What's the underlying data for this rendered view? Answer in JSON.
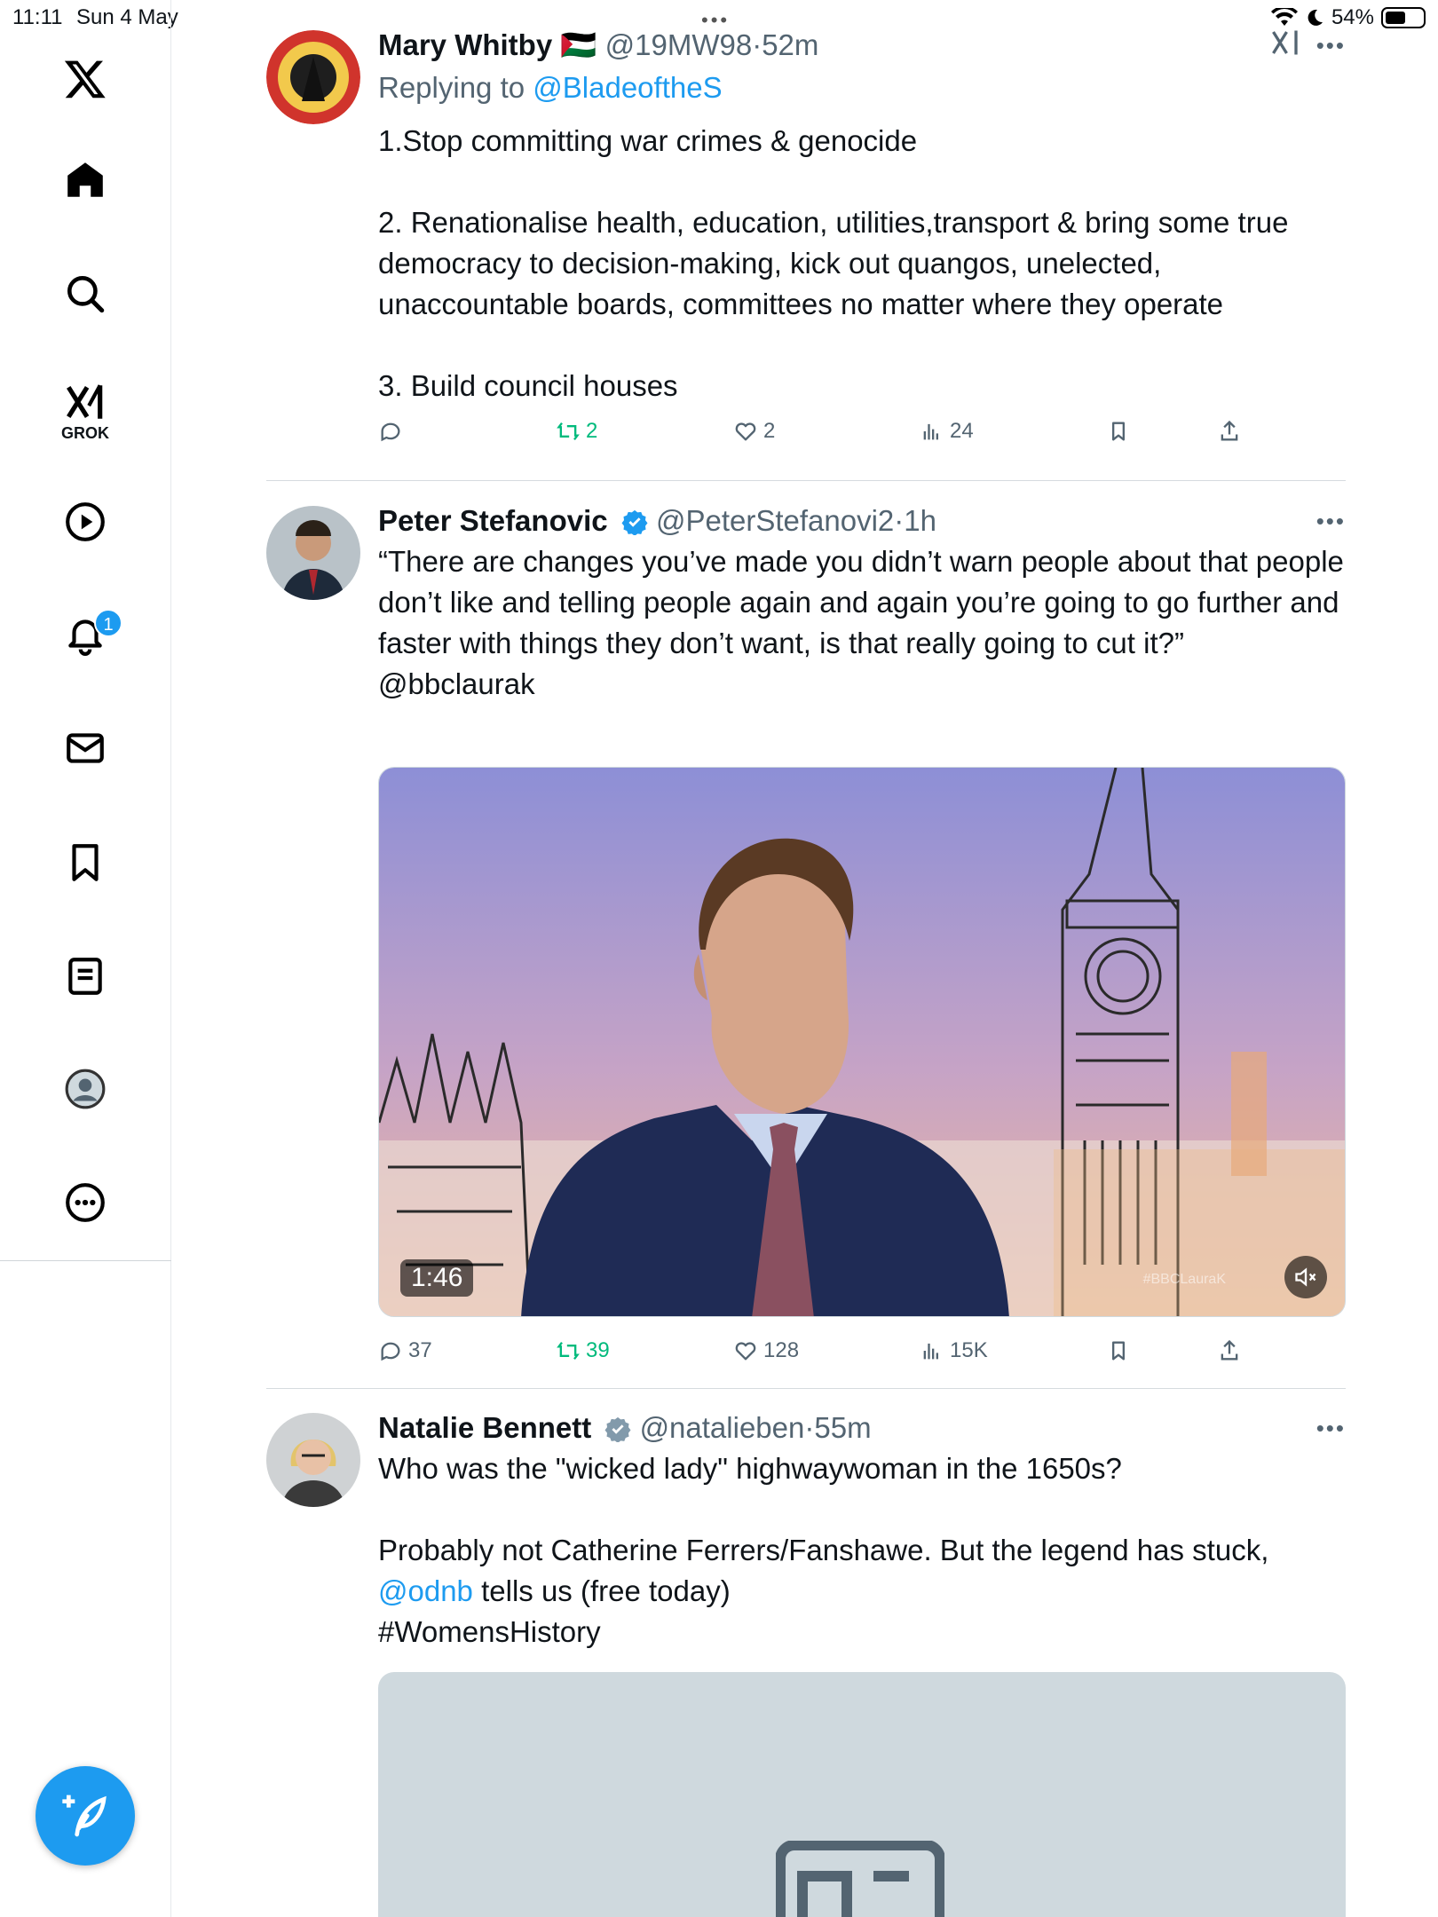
{
  "status_bar": {
    "time": "11:11",
    "date": "Sun 4 May",
    "battery": "54%"
  },
  "sidebar": {
    "items": [
      {
        "name": "logo",
        "icon": "x-logo-icon"
      },
      {
        "name": "home",
        "icon": "home-icon"
      },
      {
        "name": "explore",
        "icon": "search-icon"
      },
      {
        "name": "grok",
        "icon": "grok-icon",
        "label": "GROK"
      },
      {
        "name": "videos",
        "icon": "play-icon"
      },
      {
        "name": "notifications",
        "icon": "bell-icon",
        "badge": "1"
      },
      {
        "name": "messages",
        "icon": "mail-icon"
      },
      {
        "name": "bookmarks",
        "icon": "bookmark-icon"
      },
      {
        "name": "lists",
        "icon": "list-icon"
      },
      {
        "name": "profile",
        "icon": "avatar-icon"
      },
      {
        "name": "more",
        "icon": "more-icon"
      }
    ]
  },
  "tweets": [
    {
      "name": "Mary Whitby",
      "flag": "🇵🇸",
      "handle": "@19MW98",
      "sep": "·",
      "time": "52m",
      "reply_prefix": "Replying to ",
      "reply_to": "@BladeoftheS",
      "text": "1.Stop committing war crimes & genocide\n\n2. Renationalise health, education, utilities,transport & bring some true democracy to decision-making, kick out quangos, unelected, unaccountable boards, committees no matter where they operate\n\n3. Build council houses",
      "reply_count": "",
      "retweets": "2",
      "likes": "2",
      "views": "24"
    },
    {
      "name": "Peter Stefanovic",
      "handle": "@PeterStefanovi2",
      "sep": "·",
      "time": "1h",
      "text": "“There are changes you’ve made you didn’t warn people about that people don’t like and telling people again and again you’re going to go further and faster with things they don’t want, is that really going to cut it?”",
      "mention": "@bbclaurak",
      "video_duration": "1:46",
      "watermark": "#BBCLauraK",
      "replies": "37",
      "retweets": "39",
      "likes": "128",
      "views": "15K"
    },
    {
      "name": "Natalie Bennett",
      "handle": "@natalieben",
      "sep": "·",
      "time": "55m",
      "text1": "Who was the \"wicked lady\" highwaywoman in the 1650s?",
      "text2": "Probably not Catherine Ferrers/Fanshawe. But the legend has stuck,",
      "mention": "@odnb",
      "text3": " tells us (free today)",
      "hashtag": "#WomensHistory"
    }
  ],
  "colors": {
    "accent": "#1d9bf0",
    "retweet": "#00ba7c",
    "muted": "#536471"
  }
}
